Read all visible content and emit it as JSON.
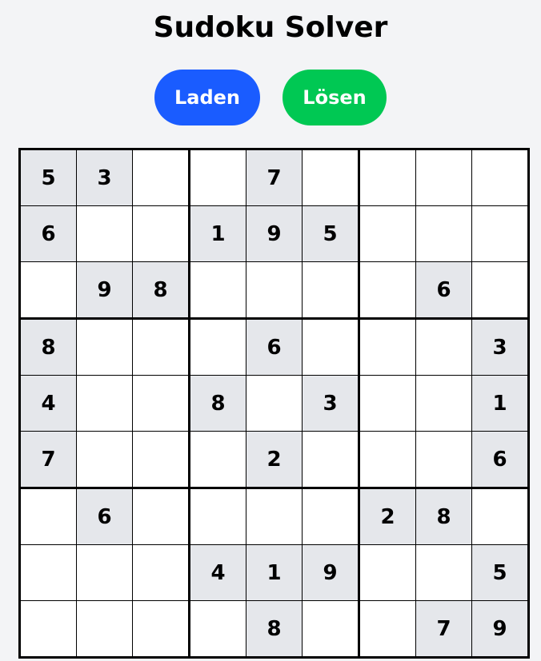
{
  "title": "Sudoku Solver",
  "buttons": {
    "load_label": "Laden",
    "solve_label": "Lösen"
  },
  "colors": {
    "load": "#1a5cff",
    "solve": "#00c853",
    "given_cell": "#e5e7eb",
    "background": "#f3f4f6"
  },
  "grid": [
    [
      "5",
      "3",
      "",
      "",
      "7",
      "",
      "",
      "",
      ""
    ],
    [
      "6",
      "",
      "",
      "1",
      "9",
      "5",
      "",
      "",
      ""
    ],
    [
      "",
      "9",
      "8",
      "",
      "",
      "",
      "",
      "6",
      ""
    ],
    [
      "8",
      "",
      "",
      "",
      "6",
      "",
      "",
      "",
      "3"
    ],
    [
      "4",
      "",
      "",
      "8",
      "",
      "3",
      "",
      "",
      "1"
    ],
    [
      "7",
      "",
      "",
      "",
      "2",
      "",
      "",
      "",
      "6"
    ],
    [
      "",
      "6",
      "",
      "",
      "",
      "",
      "2",
      "8",
      ""
    ],
    [
      "",
      "",
      "",
      "4",
      "1",
      "9",
      "",
      "",
      "5"
    ],
    [
      "",
      "",
      "",
      "",
      "8",
      "",
      "",
      "7",
      "9"
    ]
  ]
}
